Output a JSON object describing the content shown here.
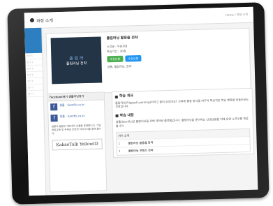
{
  "page": {
    "title": "과정 소개",
    "breadcrumb": "Home / 과정 소개"
  },
  "left_items": [
    "",
    "",
    "217 1",
    "217 1",
    "217 1",
    "217 1",
    "217 1",
    "217 1",
    "217 1",
    "217 1"
  ],
  "course": {
    "thumb_title": "플 립 러",
    "thumb_sub": "플립러닝 전략",
    "name": "플립러닝 활용을 전략",
    "meta1": "수강료 : 무료과정",
    "meta2": "학습기간 : 30일",
    "btn1": "수강신청",
    "btn2": "수강신청",
    "tag": "공통, 플립러닝, 전략"
  },
  "facebook": {
    "header": "Facebook에서 샘플러닝찾기",
    "page1": "샘플 - Samfls.co.kr",
    "page2": "샘플 - Samfls.co.kr",
    "body": "샘플의 활용은 (예)대리 상품을 운영합니다. 기업 특화교육 및 주제와 관련한 아이디어를 함께 합니다.",
    "kakao": "KakaoTalk YellowID"
  },
  "sections": {
    "intro_h": "학습 개요",
    "intro_t": "플립러닝(Flipped Learning)이라고 들어 보셨어요? 교육에 활용 방식을 바꾸어 혁신적인 학습 변화를 만들어보는 과정입니다.",
    "goal_h": "학습 내용",
    "goal_t": "샘플(Samfls)은 플립러닝을 위해 제작된 플랫폼입니다. 플립러닝을 준비하는 선생님들을 위해 운영 노하우를 제공합니다.",
    "table_h": "차시 소개",
    "rows": [
      {
        "n": "1",
        "t": "플립러닝 활용을 전략"
      },
      {
        "n": "2",
        "t": "플립러닝 콘텐츠 전략"
      }
    ]
  }
}
